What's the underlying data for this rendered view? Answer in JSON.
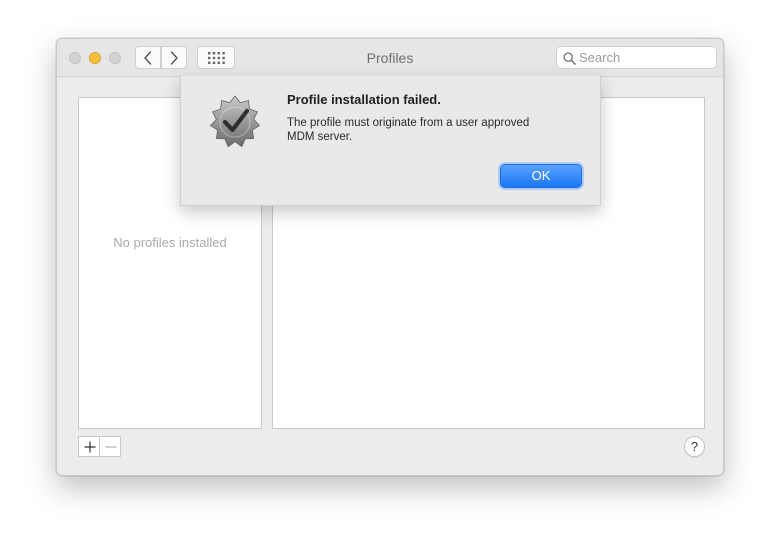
{
  "window": {
    "title": "Profiles"
  },
  "toolbar": {
    "back_icon": "chevron-left-icon",
    "forward_icon": "chevron-right-icon",
    "show_all_icon": "grid-icon",
    "search": {
      "placeholder": "Search",
      "value": ""
    }
  },
  "profiles": {
    "empty_message": "No profiles installed",
    "add_label": "+",
    "remove_label": "—"
  },
  "help": {
    "label": "?"
  },
  "alert": {
    "icon": "checkmark-seal-icon",
    "title": "Profile installation failed.",
    "message": "The profile must originate from a user approved MDM server.",
    "ok_label": "OK"
  },
  "colors": {
    "accent": "#1a78f5",
    "minimize": "#f5bf3b",
    "inactive_traffic": "#d3d3d3"
  }
}
